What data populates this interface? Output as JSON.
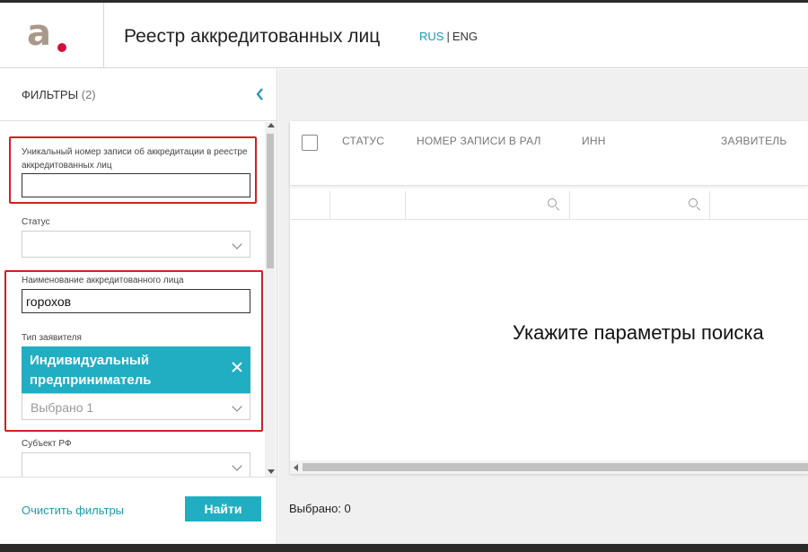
{
  "header": {
    "title": "Реестр аккредитованных лиц",
    "logo_letter": "a",
    "lang_active": "RUS",
    "lang_separator": "|",
    "lang_other": "ENG"
  },
  "filters": {
    "title": "ФИЛЬТРЫ",
    "count": "(2)",
    "collapse_icon": "chevron-left-icon",
    "accreditation_number": {
      "label": "Уникальный номер записи об аккредитации в реестре аккредитованных лиц",
      "value": ""
    },
    "status": {
      "label": "Статус",
      "value": ""
    },
    "entity_name": {
      "label": "Наименование аккредитованного лица",
      "value": "горохов"
    },
    "applicant_type": {
      "label": "Тип заявителя",
      "chip": "Индивидуальный предприниматель",
      "summary": "Выбрано 1"
    },
    "region": {
      "label": "Субъект РФ",
      "value": ""
    },
    "clear_label": "Очистить фильтры",
    "find_label": "Найти"
  },
  "table": {
    "columns": [
      "СТАТУС",
      "НОМЕР ЗАПИСИ В РАЛ",
      "ИНН",
      "ЗАЯВИТЕЛЬ"
    ],
    "empty_message": "Укажите параметры поиска",
    "selected_label": "Выбрано: 0"
  },
  "colors": {
    "accent": "#21aec2",
    "link": "#1a9cb0",
    "highlight_frame": "#d32020",
    "logo_dot": "#d0103a",
    "logo_letter": "#a9998b"
  }
}
